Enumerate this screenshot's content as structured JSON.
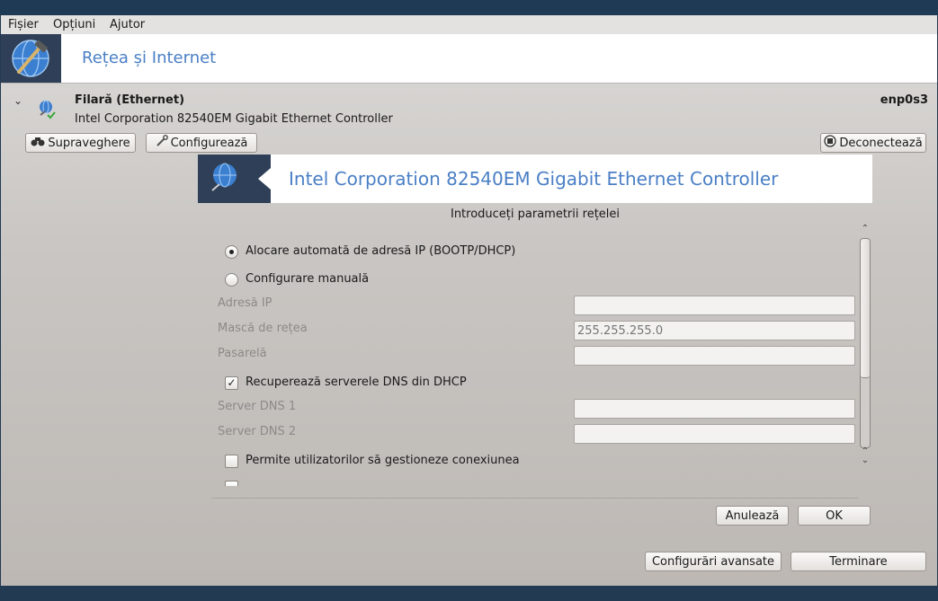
{
  "menubar": {
    "items": [
      "Fișier",
      "Opțiuni",
      "Ajutor"
    ]
  },
  "banner": {
    "title": "Rețea și Internet",
    "icon": "tools-globe-icon"
  },
  "connection": {
    "title": "Filară (Ethernet)",
    "description": "Intel Corporation 82540EM Gigabit Ethernet Controller",
    "interface": "enp0s3",
    "monitor_label": "Supraveghere",
    "configure_label": "Configurează",
    "disconnect_label": "Deconectează"
  },
  "dialog": {
    "title": "Intel Corporation 82540EM Gigabit Ethernet Controller",
    "subtitle": "Introduceți parametrii rețelei",
    "auto_ip_label": "Alocare automată de adresă IP (BOOTP/DHCP)",
    "manual_label": "Configurare manuală",
    "ip_label": "Adresă IP",
    "ip_value": "",
    "netmask_label": "Mască de rețea",
    "netmask_placeholder": "255.255.255.0",
    "gateway_label": "Pasarelă",
    "gateway_value": "",
    "dns_dhcp_label": "Recuperează serverele DNS din DHCP",
    "dns1_label": "Server DNS 1",
    "dns1_value": "",
    "dns2_label": "Server DNS 2",
    "dns2_value": "",
    "allow_users_label": "Permite utilizatorilor să gestioneze conexiunea",
    "cancel_label": "Anulează",
    "ok_label": "OK"
  },
  "footer": {
    "advanced_label": "Configurări avansate",
    "finish_label": "Terminare"
  },
  "colors": {
    "accent": "#4a7fc5",
    "header_icon_bg": "#2e3f57"
  }
}
